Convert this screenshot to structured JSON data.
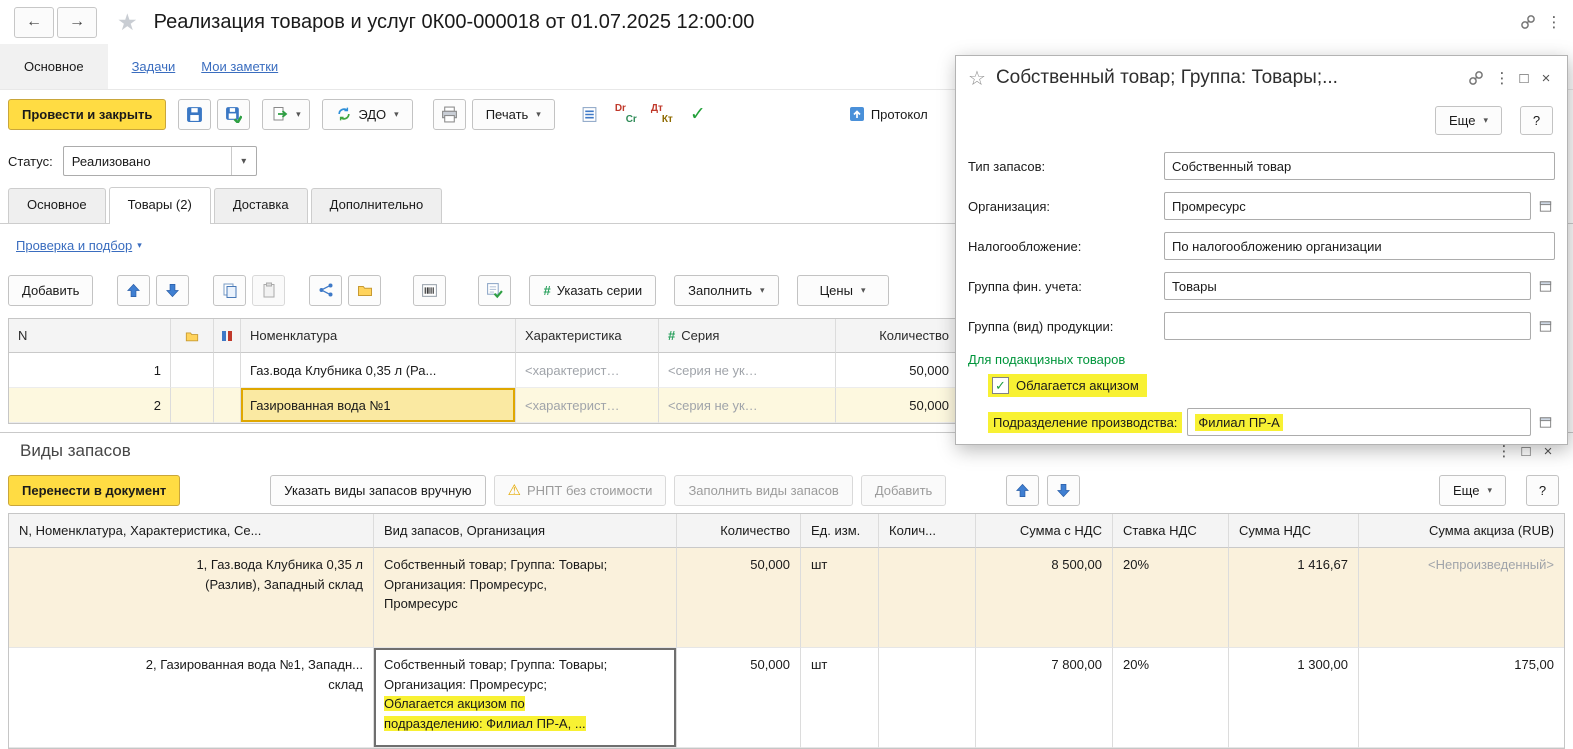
{
  "icons": {
    "back": "←",
    "forward": "→",
    "star": "★",
    "star_outline": "☆",
    "dots": "⋮",
    "maximize": "□",
    "close": "×",
    "dropdown": "▾",
    "check": "✓",
    "warning": "⚠",
    "hash": "#"
  },
  "common": {
    "more": "Еще",
    "help": "?"
  },
  "titlebar": {
    "title": "Реализация товаров и услуг 0К00-000018 от 01.07.2025 12:00:00"
  },
  "nav": {
    "main": "Основное",
    "tasks": "Задачи",
    "notes": "Мои заметки"
  },
  "toolbar": {
    "post_close": "Провести и закрыть",
    "edo": "ЭДО",
    "print_menu": "Печать",
    "dr": "Dr",
    "cr": "Cr",
    "dt": "Дт",
    "kt": "Кт",
    "protocol": "Протокол"
  },
  "status": {
    "label": "Статус:",
    "value": "Реализовано"
  },
  "tabs": {
    "main": "Основное",
    "goods": "Товары (2)",
    "delivery": "Доставка",
    "extra": "Дополнительно"
  },
  "check_link": {
    "label": "Проверка и подбор"
  },
  "goods": {
    "add": "Добавить",
    "series_btn": "Указать серии",
    "fill_btn": "Заполнить",
    "prices_btn": "Цены",
    "headers": {
      "n": "N",
      "nom": "Номенклатура",
      "char": "Характеристика",
      "series": "Серия",
      "qty": "Количество"
    },
    "rows": [
      {
        "n": "1",
        "nom": "Газ.вода Клубника 0,35 л (Ра...",
        "char": "<характерист…",
        "series": "<серия не ук…",
        "qty": "50,000"
      },
      {
        "n": "2",
        "nom": "Газированная вода №1",
        "char": "<характерист…",
        "series": "<серия не ук…",
        "qty": "50,000"
      }
    ]
  },
  "dialog": {
    "title": "Собственный товар; Группа: Товары;...",
    "fields": {
      "type": {
        "label": "Тип запасов:",
        "value": "Собственный товар"
      },
      "org": {
        "label": "Организация:",
        "value": "Промресурс"
      },
      "tax": {
        "label": "Налогообложение:",
        "value": "По налогообложению организации"
      },
      "fin_group": {
        "label": "Группа фин. учета:",
        "value": "Товары"
      },
      "prod_group": {
        "label": "Группа (вид) продукции:",
        "value": ""
      }
    },
    "excise_header": "Для подакцизных товаров",
    "excise_checkbox": "Облагается акцизом",
    "division": {
      "label": "Подразделение производства:",
      "value": "Филиал ПР-А"
    }
  },
  "stock": {
    "title": "Виды запасов",
    "transfer_btn": "Перенести в документ",
    "manual_btn": "Указать виды запасов вручную",
    "rnpt_btn": "РНПТ без стоимости",
    "fill_btn": "Заполнить виды запасов",
    "add_btn": "Добавить",
    "headers": [
      "N, Номенклатура, Характеристика, Се...",
      "Вид запасов, Организация",
      "Количество",
      "Ед. изм.",
      "Колич...",
      "Сумма с НДС",
      "Ставка НДС",
      "Сумма НДС",
      "Сумма акциза (RUB)"
    ],
    "rows": [
      {
        "item_lines": [
          "1, Газ.вода Клубника 0,35 л",
          "(Разлив), Западный склад"
        ],
        "type_lines": [
          "Собственный товар; Группа: Товары;",
          "Организация: Промресурс,",
          "Промресурс"
        ],
        "qty": "50,000",
        "unit": "шт",
        "qty2": "",
        "sum_vat": "8 500,00",
        "vat_rate": "20%",
        "vat_sum": "1 416,67",
        "excise": "<Непроизведенный>"
      },
      {
        "item_lines": [
          "2, Газированная вода №1, Западн...",
          "склад"
        ],
        "type_lines": [
          "Собственный товар; Группа: Товары;",
          "Организация: Промресурс;"
        ],
        "type_highlight_lines": [
          "Облагается акцизом по",
          "подразделению: Филиал ПР-А, ..."
        ],
        "qty": "50,000",
        "unit": "шт",
        "qty2": "",
        "sum_vat": "7 800,00",
        "vat_rate": "20%",
        "vat_sum": "1 300,00",
        "excise": "175,00"
      }
    ]
  }
}
